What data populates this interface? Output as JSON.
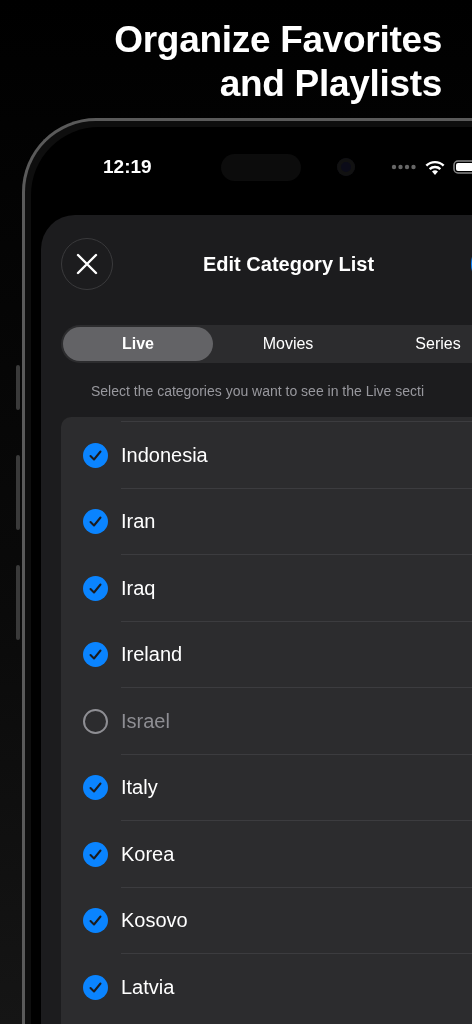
{
  "headline": [
    "Organize Favorites",
    "and Playlists"
  ],
  "status_bar": {
    "time": "12:19"
  },
  "header": {
    "title": "Edit Category List"
  },
  "tabs": [
    {
      "label": "Live",
      "selected": true
    },
    {
      "label": "Movies",
      "selected": false
    },
    {
      "label": "Series",
      "selected": false
    }
  ],
  "hint": "Select the categories you want to see in the Live secti",
  "categories": [
    {
      "name": "Indonesia",
      "checked": true
    },
    {
      "name": "Iran",
      "checked": true
    },
    {
      "name": "Iraq",
      "checked": true
    },
    {
      "name": "Ireland",
      "checked": true
    },
    {
      "name": "Israel",
      "checked": false
    },
    {
      "name": "Italy",
      "checked": true
    },
    {
      "name": "Korea",
      "checked": true
    },
    {
      "name": "Kosovo",
      "checked": true
    },
    {
      "name": "Latvia",
      "checked": true
    }
  ]
}
